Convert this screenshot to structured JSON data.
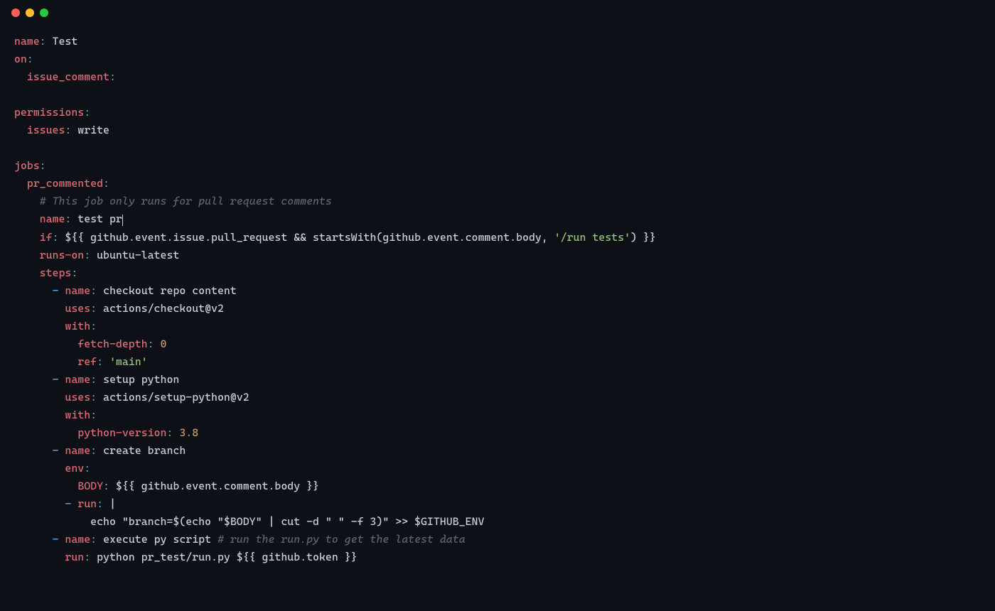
{
  "file_type": "yaml",
  "editor": "code-editor-window",
  "lines": {
    "l1_key": "name",
    "l1_colon": ":",
    "l1_val": " Test",
    "l2_key": "on",
    "l2_colon": ":",
    "l3_key": "issue_comment",
    "l3_colon": ":",
    "l5_key": "permissions",
    "l5_colon": ":",
    "l6_key": "issues",
    "l6_colon": ":",
    "l6_val": " write",
    "l8_key": "jobs",
    "l8_colon": ":",
    "l9_key": "pr_commented",
    "l9_colon": ":",
    "l10_comment": "# This job only runs for pull request comments",
    "l11_key": "name",
    "l11_colon": ":",
    "l11_val": " test pr",
    "l12_key": "if",
    "l12_colon": ":",
    "l12_v1": " ${{ github.event.issue.pull_request && startsWith(github.event.comment.body, ",
    "l12_s": "'/run tests'",
    "l12_v2": ") }}",
    "l13_key": "runs-on",
    "l13_colon": ":",
    "l13_val": " ubuntu-latest",
    "l14_key": "steps",
    "l14_colon": ":",
    "l15_dash": "- ",
    "l15_key": "name",
    "l15_colon": ":",
    "l15_val": " checkout repo content",
    "l16_key": "uses",
    "l16_colon": ":",
    "l16_val": " actions/checkout@v2",
    "l17_key": "with",
    "l17_colon": ":",
    "l18_key": "fetch-depth",
    "l18_colon": ":",
    "l18_val": " 0",
    "l19_key": "ref",
    "l19_colon": ":",
    "l19_s": " 'main'",
    "l20_dash": "- ",
    "l20_key": "name",
    "l20_colon": ":",
    "l20_val": " setup python",
    "l21_key": "uses",
    "l21_colon": ":",
    "l21_val": " actions/setup-python@v2",
    "l22_key": "with",
    "l22_colon": ":",
    "l23_key": "python-version",
    "l23_colon": ":",
    "l23_val": " 3.8",
    "l24_dash": "- ",
    "l24_key": "name",
    "l24_colon": ":",
    "l24_val": " create branch",
    "l25_key": "env",
    "l25_colon": ":",
    "l26_key": "BODY",
    "l26_colon": ":",
    "l26_val": " ${{ github.event.comment.body }}",
    "l27_dash": "- ",
    "l27_key": "run",
    "l27_colon": ":",
    "l27_val": " |",
    "l28_val": "echo \"branch=$(echo \"$BODY\" | cut -d \" \" -f 3)\" >> $GITHUB_ENV",
    "l29_dash": "- ",
    "l29_key": "name",
    "l29_colon": ":",
    "l29_val": " execute py script ",
    "l29_comment": "# run the run.py to get the latest data",
    "l30_key": "run",
    "l30_colon": ":",
    "l30_val": " python pr_test/run.py ${{ github.token }}"
  }
}
